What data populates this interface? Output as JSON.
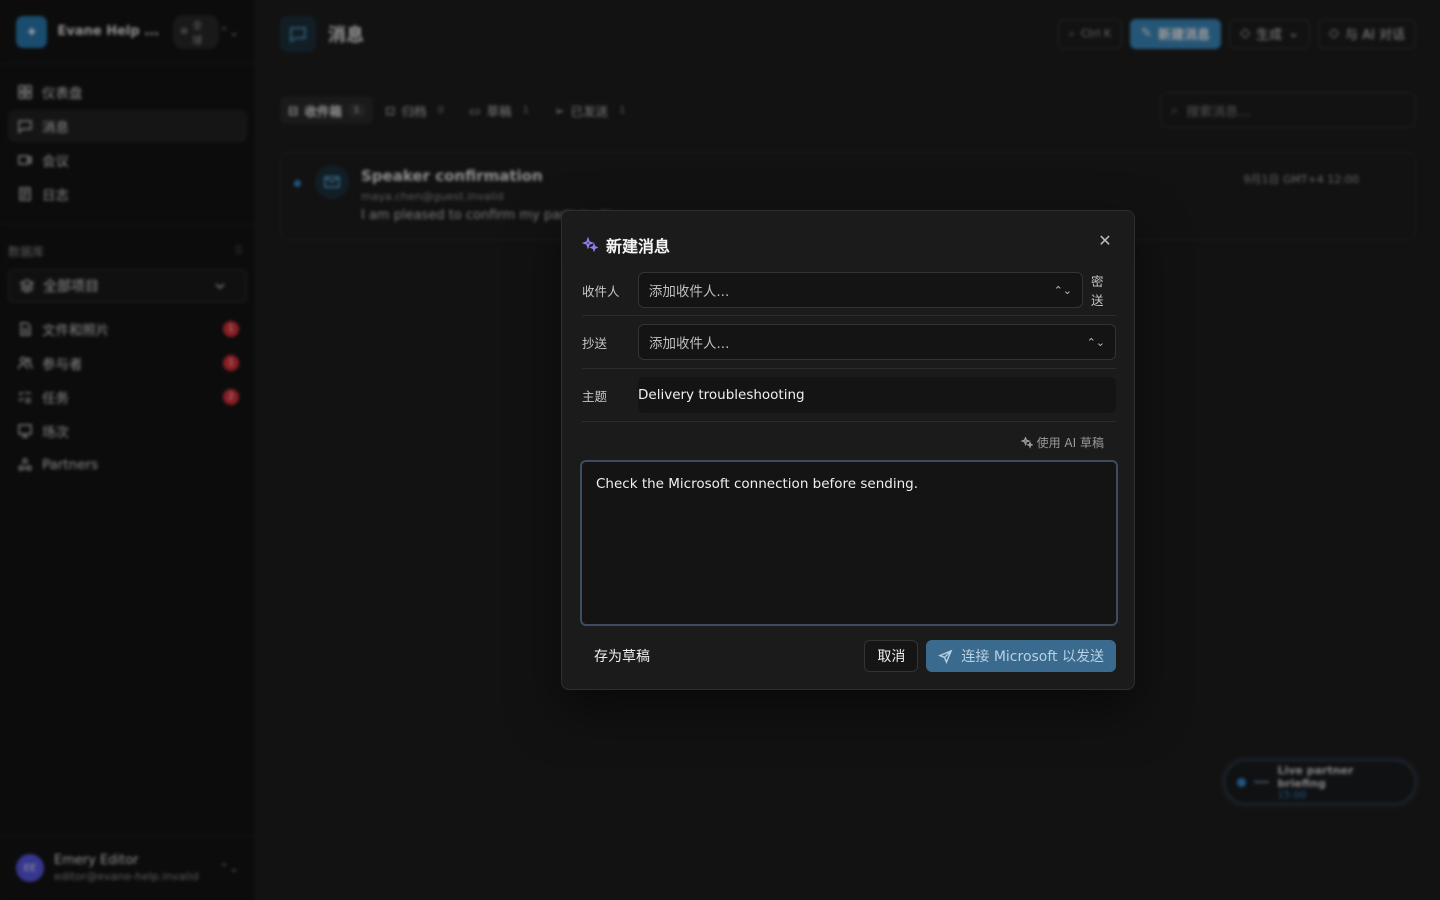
{
  "workspace": {
    "name": "Evane Help ...",
    "scope": "全球"
  },
  "nav": [
    {
      "label": "仪表盘",
      "icon": "dashboard-icon"
    },
    {
      "label": "消息",
      "icon": "message-icon",
      "active": true
    },
    {
      "label": "会议",
      "icon": "video-icon"
    },
    {
      "label": "日志",
      "icon": "log-icon"
    }
  ],
  "database": {
    "section_label": "数据库",
    "selector": "全部项目",
    "items": [
      {
        "label": "文件和照片",
        "count": "1"
      },
      {
        "label": "参与者",
        "count": "1"
      },
      {
        "label": "任务",
        "count": "2"
      },
      {
        "label": "场次",
        "count": ""
      },
      {
        "label": "Partners",
        "count": ""
      }
    ]
  },
  "user": {
    "initials": "EE",
    "name": "Emery Editor",
    "email": "editor@evane-help.invalid"
  },
  "page": {
    "title": "消息"
  },
  "top_actions": {
    "shortcut": "Ctrl K",
    "new_message": "新建消息",
    "generate": "生成",
    "ai_chat": "与 AI 对话"
  },
  "tabs": [
    {
      "label": "收件箱",
      "count": "1",
      "active": true
    },
    {
      "label": "归档",
      "count": "0"
    },
    {
      "label": "草稿",
      "count": "1"
    },
    {
      "label": "已发送",
      "count": "1"
    }
  ],
  "search": {
    "placeholder": "搜索消息..."
  },
  "message": {
    "subject": "Speaker confirmation",
    "from": "maya.chen@guest.invalid",
    "preview": "I am pleased to confirm my participation",
    "date": "9月1日 GMT+4 12:00"
  },
  "toast": {
    "title": "Live partner briefing",
    "time": "15:00"
  },
  "modal": {
    "title": "新建消息",
    "to_label": "收件人",
    "to_placeholder": "添加收件人...",
    "bcc_label": "密送",
    "cc_label": "抄送",
    "cc_placeholder": "添加收件人...",
    "subject_label": "主题",
    "subject_value": "Delivery troubleshooting",
    "ai_draft": "使用 AI 草稿",
    "body": "Check the Microsoft connection before sending.",
    "save_draft": "存为草稿",
    "cancel": "取消",
    "send": "连接 Microsoft 以发送"
  },
  "colors": {
    "accent": "#3f8fc6",
    "badge": "#e5323d",
    "ai": "#8f7ff0"
  }
}
